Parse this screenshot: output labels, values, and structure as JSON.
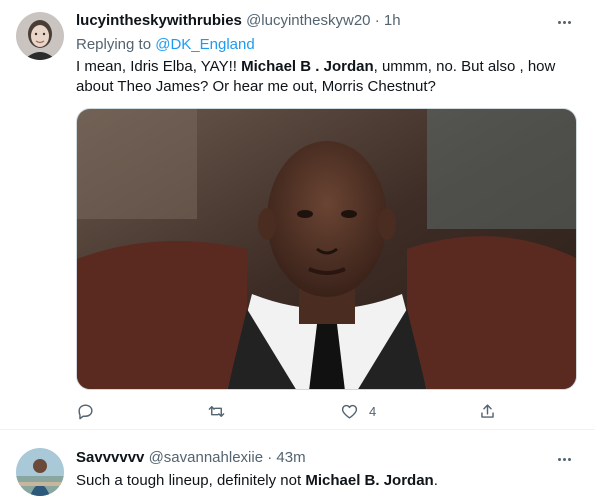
{
  "tweets": [
    {
      "name": "lucyintheskywithrubies",
      "handle": "@lucyintheskyw20",
      "dot": "·",
      "time": "1h",
      "replying_prefix": "Replying to ",
      "replying_to": "@DK_England",
      "text_seg1": "I mean, Idris Elba, YAY!! ",
      "text_bold1": "Michael B . Jordan",
      "text_seg2": ", ummm, no. But also , how",
      "text_line2": "about Theo James? Or hear me out, Morris Chestnut?",
      "actions": {
        "reply_count": "",
        "retweet_count": "",
        "like_count": "4"
      }
    },
    {
      "name": "Savvvvvv",
      "handle": "@savannahlexiie",
      "dot": "·",
      "time": "43m",
      "text_seg1": "Such a tough lineup, definitely not ",
      "text_bold1": "Michael B. Jordan",
      "text_seg2": "."
    }
  ],
  "icons": [
    "more-icon",
    "reply-icon",
    "retweet-icon",
    "like-icon",
    "share-icon"
  ],
  "colors": {
    "link": "#1d9bf0",
    "muted": "#536471",
    "text": "#0f1419",
    "divider": "#eff3f4"
  }
}
